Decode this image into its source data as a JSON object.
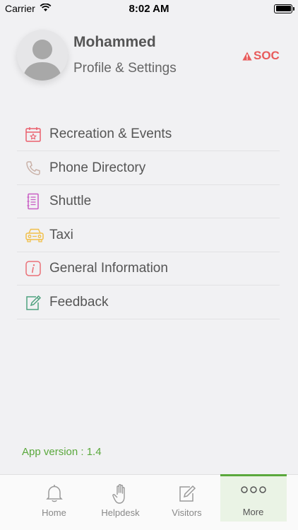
{
  "status_bar": {
    "carrier": "Carrier",
    "time": "8:02 AM"
  },
  "profile": {
    "name": "Mohammed",
    "subtitle": "Profile & Settings",
    "soc_label": "SOC"
  },
  "menu": {
    "items": [
      {
        "label": "Recreation & Events",
        "icon": "calendar-star-icon",
        "color": "#ea5f6d"
      },
      {
        "label": "Phone Directory",
        "icon": "phone-icon",
        "color": "#c9b1a8"
      },
      {
        "label": "Shuttle",
        "icon": "notebook-icon",
        "color": "#c95fc4"
      },
      {
        "label": "Taxi",
        "icon": "taxi-icon",
        "color": "#f1c04b"
      },
      {
        "label": "General Information",
        "icon": "info-icon",
        "color": "#ea7178"
      },
      {
        "label": "Feedback",
        "icon": "feedback-edit-icon",
        "color": "#4fa27f"
      }
    ]
  },
  "app_version": "App version : 1.4",
  "tabbar": {
    "tabs": [
      {
        "label": "Home",
        "icon": "bell-icon",
        "active": false
      },
      {
        "label": "Helpdesk",
        "icon": "hand-icon",
        "active": false
      },
      {
        "label": "Visitors",
        "icon": "visitors-edit-icon",
        "active": false
      },
      {
        "label": "More",
        "icon": "more-dots-icon",
        "active": true
      }
    ]
  },
  "colors": {
    "accent": "#5aa83c",
    "danger": "#e85b5b",
    "background": "#f1f1f3"
  }
}
